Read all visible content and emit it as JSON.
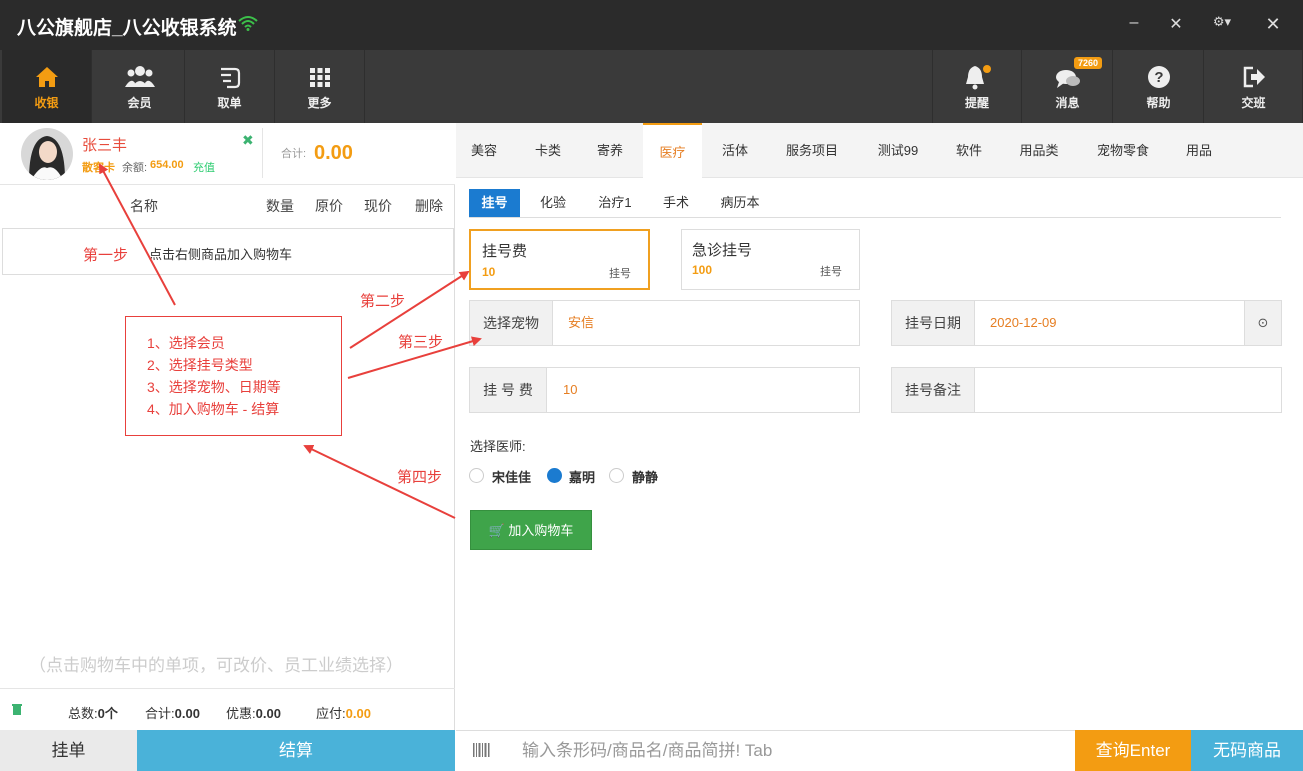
{
  "window": {
    "title": "八公旗舰店_八公收银系统"
  },
  "nav": {
    "items": [
      {
        "label": "收银",
        "icon": "home-icon"
      },
      {
        "label": "会员",
        "icon": "users-icon"
      },
      {
        "label": "取单",
        "icon": "hand-icon"
      },
      {
        "label": "更多",
        "icon": "grid-icon"
      }
    ],
    "right_items": [
      {
        "label": "提醒",
        "icon": "bell-icon"
      },
      {
        "label": "消息",
        "icon": "chat-icon",
        "badge": "7260"
      },
      {
        "label": "帮助",
        "icon": "question-icon"
      },
      {
        "label": "交班",
        "icon": "logout-icon"
      }
    ]
  },
  "member": {
    "name": "张三丰",
    "card_type": "散客卡",
    "balance_label": "余额:",
    "balance": "654.00",
    "recharge": "充值",
    "total_label": "合计:",
    "total": "0.00"
  },
  "cart": {
    "columns": [
      "名称",
      "数量",
      "原价",
      "现价",
      "删除"
    ],
    "tip": "点击右侧商品加入购物车",
    "hint": "（点击购物车中的单项，可改价、员工业绩选择）",
    "summary": {
      "count_label": "总数:",
      "count": "0个",
      "total_label": "合计:",
      "total": "0.00",
      "discount_label": "优惠:",
      "discount": "0.00",
      "payable_label": "应付:",
      "payable": "0.00"
    },
    "hang_button": "挂单",
    "checkout_button": "结算"
  },
  "categories": [
    "美容",
    "卡类",
    "寄养",
    "医疗",
    "活体",
    "服务项目",
    "测试99",
    "软件",
    "用品类",
    "宠物零食",
    "用品"
  ],
  "active_category": "医疗",
  "subtabs": [
    "挂号",
    "化验",
    "治疗1",
    "手术",
    "病历本"
  ],
  "active_subtab": "挂号",
  "reg_cards": [
    {
      "title": "挂号费",
      "price": "10",
      "type": "挂号"
    },
    {
      "title": "急诊挂号",
      "price": "100",
      "type": "挂号"
    }
  ],
  "form": {
    "pet_label": "选择宠物",
    "pet_value": "安信",
    "date_label": "挂号日期",
    "date_value": "2020-12-09",
    "fee_label": "挂 号 费",
    "fee_value": "10",
    "remark_label": "挂号备注",
    "remark_value": ""
  },
  "doctor": {
    "label": "选择医师:",
    "options": [
      "宋佳佳",
      "嘉明",
      "静静"
    ],
    "selected": "嘉明"
  },
  "add_to_cart": "加入购物车",
  "search": {
    "placeholder": "输入条形码/商品名/商品简拼! Tab"
  },
  "query_button": "查询Enter",
  "nobarcode_button": "无码商品",
  "annotations": {
    "step1": "第一步",
    "step2": "第二步",
    "step3": "第三步",
    "step4": "第四步",
    "steps": [
      "1、选择会员",
      "2、选择挂号类型",
      "3、选择宠物、日期等",
      "4、加入购物车 - 结算"
    ]
  },
  "colors": {
    "accent": "#f39c12",
    "blue": "#1b7bd0",
    "green": "#3fa44a",
    "annotation": "#e8403c"
  }
}
